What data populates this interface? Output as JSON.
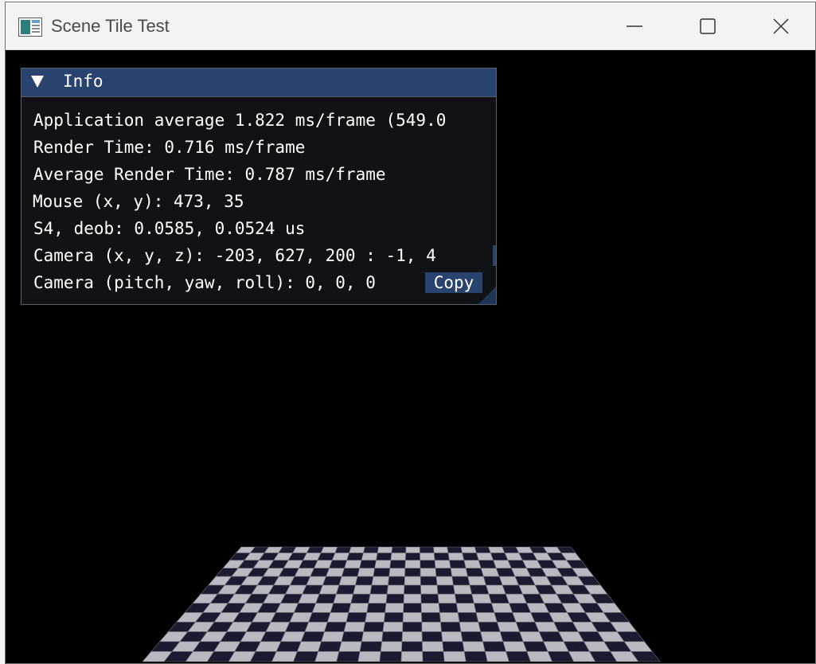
{
  "window": {
    "title": "Scene Tile Test",
    "controls": {
      "minimize": "minimize-icon",
      "maximize": "maximize-icon",
      "close": "close-icon"
    }
  },
  "info_panel": {
    "title": "Info",
    "lines": [
      "Application average 1.822 ms/frame (549.0",
      "Render Time: 0.716 ms/frame",
      "Average Render Time: 0.787 ms/frame",
      "Mouse (x, y): 473, 35",
      "S4, deob: 0.0585, 0.0524 us",
      "Camera (x, y, z): -203, 627, 200 : -1, 4",
      "Camera (pitch, yaw, roll): 0, 0, 0"
    ],
    "copy_label": "Copy"
  },
  "colors": {
    "panel_title_bg": "#28436e",
    "panel_bg": "#111215",
    "viewport_bg": "#000000",
    "tile_light": "#b9b9c2",
    "tile_dark": "#1a1a30"
  }
}
